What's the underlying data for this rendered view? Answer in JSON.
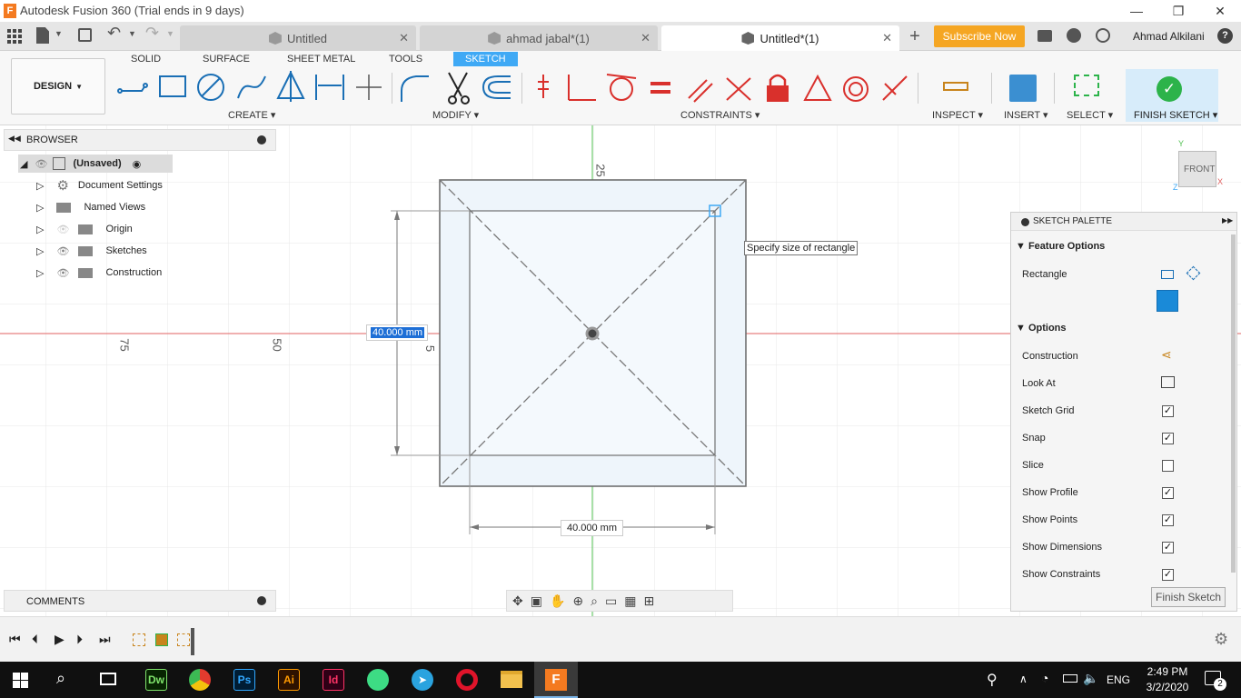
{
  "window": {
    "title": "Autodesk Fusion 360 (Trial ends in 9 days)",
    "minimize": "—",
    "maximize": "❐",
    "close": "✕"
  },
  "tabs": [
    {
      "label": "Untitled"
    },
    {
      "label": "ahmad jabal*(1)"
    },
    {
      "label": "Untitled*(1)"
    }
  ],
  "header": {
    "subscribe": "Subscribe Now",
    "user": "Ahmad Alkilani"
  },
  "ribbon": {
    "workspace": "DESIGN",
    "tabs": [
      "SOLID",
      "SURFACE",
      "SHEET METAL",
      "TOOLS",
      "SKETCH"
    ],
    "groups": {
      "create": "CREATE",
      "modify": "MODIFY",
      "constraints": "CONSTRAINTS",
      "inspect": "INSPECT",
      "insert": "INSERT",
      "select": "SELECT",
      "finish": "FINISH SKETCH"
    }
  },
  "browser": {
    "title": "BROWSER",
    "root": "(Unsaved)",
    "items": [
      "Document Settings",
      "Named Views",
      "Origin",
      "Sketches",
      "Construction"
    ]
  },
  "comments": {
    "title": "COMMENTS"
  },
  "canvas": {
    "dim_input": "40.000 mm",
    "dim_bottom": "40.000 mm",
    "tooltip": "Specify size of rectangle",
    "ruler_top": "25",
    "ruler_75": "75",
    "ruler_50": "50",
    "ruler_5": "5",
    "viewcube": "FRONT",
    "axis_y": "Y",
    "axis_z": "Z",
    "axis_x": "X"
  },
  "palette": {
    "title": "SKETCH PALETTE",
    "feature_options": "Feature Options",
    "rectangle": "Rectangle",
    "options": "Options",
    "rows": [
      {
        "label": "Construction",
        "type": "icon"
      },
      {
        "label": "Look At",
        "type": "icon"
      },
      {
        "label": "Sketch Grid",
        "checked": true
      },
      {
        "label": "Snap",
        "checked": true
      },
      {
        "label": "Slice",
        "checked": false
      },
      {
        "label": "Show Profile",
        "checked": true
      },
      {
        "label": "Show Points",
        "checked": true
      },
      {
        "label": "Show Dimensions",
        "checked": true
      },
      {
        "label": "Show Constraints",
        "checked": true
      }
    ],
    "finish_button": "Finish Sketch"
  },
  "taskbar": {
    "lang": "ENG",
    "time": "2:49 PM",
    "date": "3/2/2020",
    "notifications": "2",
    "apps": [
      "Dw",
      "Ps",
      "Ai",
      "Id"
    ]
  },
  "colors": {
    "accent": "#3fa9f5",
    "subscribe": "#f5a623",
    "finish_check": "#2cb34a",
    "constraint_red": "#d9302c"
  }
}
